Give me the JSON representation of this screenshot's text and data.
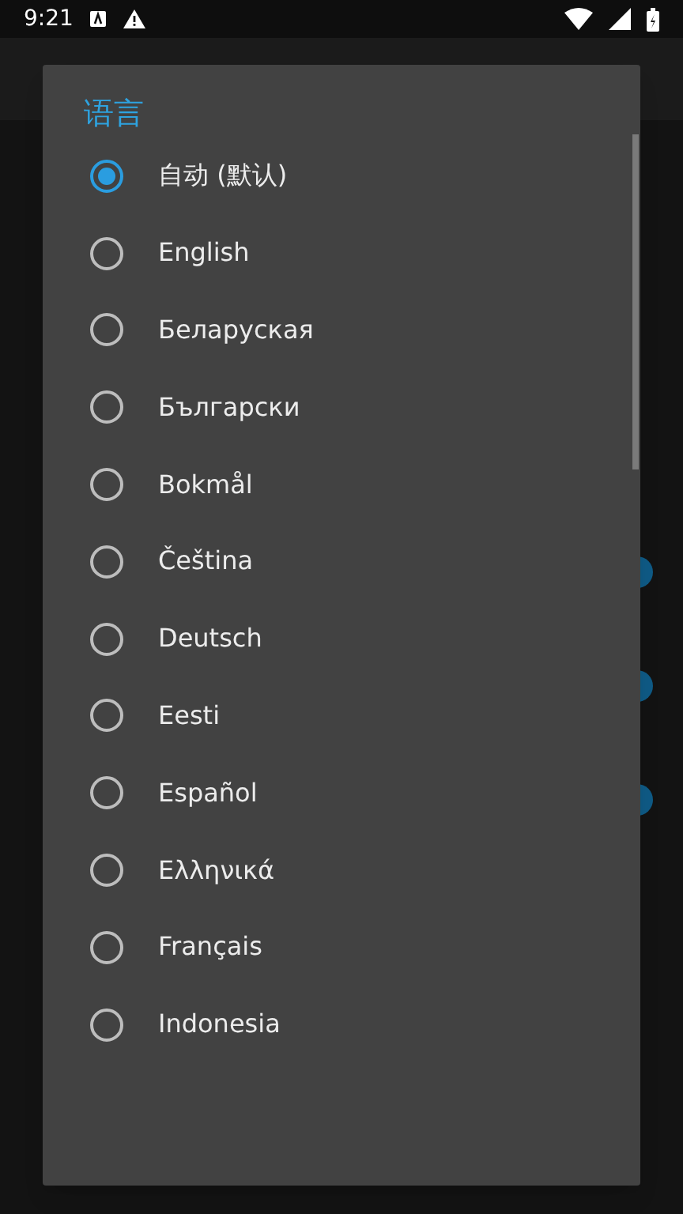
{
  "status_bar": {
    "time": "9:21"
  },
  "background_switches": [
    {
      "on": true
    },
    {
      "on": true
    },
    {
      "on": true
    }
  ],
  "dialog": {
    "title": "语言",
    "options": [
      {
        "label": "自动 (默认)",
        "selected": true
      },
      {
        "label": "English",
        "selected": false
      },
      {
        "label": "Беларуская",
        "selected": false
      },
      {
        "label": "Български",
        "selected": false
      },
      {
        "label": "Bokmål",
        "selected": false
      },
      {
        "label": "Čeština",
        "selected": false
      },
      {
        "label": "Deutsch",
        "selected": false
      },
      {
        "label": "Eesti",
        "selected": false
      },
      {
        "label": "Español",
        "selected": false
      },
      {
        "label": "Ελληνικά",
        "selected": false
      },
      {
        "label": "Français",
        "selected": false
      },
      {
        "label": "Indonesia",
        "selected": false
      }
    ]
  }
}
